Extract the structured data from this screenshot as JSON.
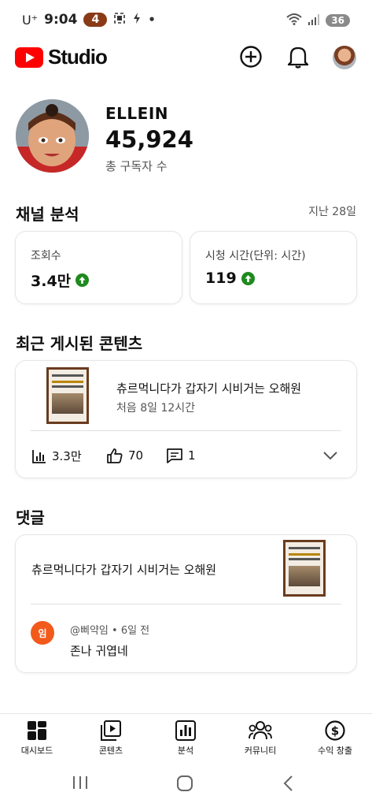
{
  "status_bar": {
    "carrier": "U⁺",
    "time": "9:04",
    "notification_count": "4",
    "battery": "36"
  },
  "header": {
    "app_name": "Studio"
  },
  "channel": {
    "name": "ELLEIN",
    "subscribers": "45,924",
    "subscribers_label": "총 구독자 수"
  },
  "analytics": {
    "title": "채널 분석",
    "range": "지난 28일",
    "views_label": "조회수",
    "views_value": "3.4만",
    "watch_label": "시청 시간(단위: 시간)",
    "watch_value": "119"
  },
  "recent": {
    "title": "최근 게시된 콘텐츠",
    "video_title": "츄르먹니다가 갑자기 시비거는 오해원",
    "video_meta": "처음 8일 12시간",
    "views": "3.3만",
    "likes": "70",
    "comments": "1"
  },
  "comments": {
    "title": "댓글",
    "video_title": "츄르먹니다가 갑자기 시비거는 오해원",
    "avatar_letter": "임",
    "author_line": "@삐약임 • 6일 전",
    "text": "존나 귀엽네"
  },
  "nav": {
    "dashboard": "대시보드",
    "content": "콘텐츠",
    "analytics": "분석",
    "community": "커뮤니티",
    "earn": "수익 창출"
  },
  "colors": {
    "brand": "#ff0000",
    "up_arrow": "#1e8a1e",
    "comment_avatar": "#f25a1c",
    "thumb_border": "#6a3b1e"
  }
}
